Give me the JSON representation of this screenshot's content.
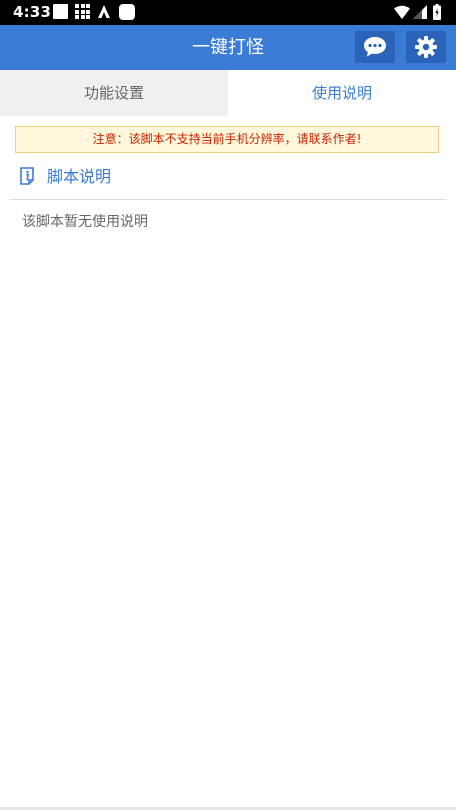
{
  "status_bar": {
    "time": "4:33",
    "icons": [
      "notification-square-icon",
      "grid-app-icon",
      "a-app-icon",
      "rounded-app-icon",
      "wifi-icon",
      "signal-icon",
      "battery-icon"
    ]
  },
  "app_bar": {
    "title": "一键打怪",
    "color": "#3a7bd5",
    "actions": [
      "chat-icon",
      "gear-icon"
    ]
  },
  "tabs": [
    {
      "label": "功能设置",
      "selected": false
    },
    {
      "label": "使用说明",
      "selected": true
    }
  ],
  "notice": {
    "text": "注意：该脚本不支持当前手机分辨率，请联系作者!"
  },
  "section": {
    "title": "脚本说明",
    "icon": "info-icon",
    "body": "该脚本暂无使用说明"
  }
}
